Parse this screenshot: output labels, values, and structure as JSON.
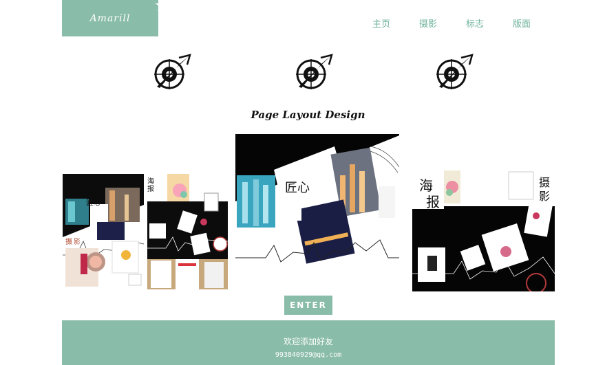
{
  "brand": {
    "logo_text": "Amarill"
  },
  "nav": {
    "items": [
      "主页",
      "摄影",
      "标志",
      "版面"
    ]
  },
  "main": {
    "headline": "Page Layout Design",
    "enter_label": "ENTER",
    "panel_left": {
      "word_a": "匠心",
      "word_b": "摄影",
      "word_c": "海报"
    },
    "panel_center": {
      "word_a": "匠心"
    },
    "panel_right": {
      "word_a": "海",
      "word_b": "报",
      "word_c": "摄",
      "word_d": "影"
    }
  },
  "footer": {
    "line1": "欢迎添加好友",
    "line2": "993840929@qq.com"
  },
  "colors": {
    "accent": "#8abcaa",
    "nav_text": "#6fb39b"
  },
  "icons": [
    "star-icon",
    "compass-emblem-icon"
  ]
}
